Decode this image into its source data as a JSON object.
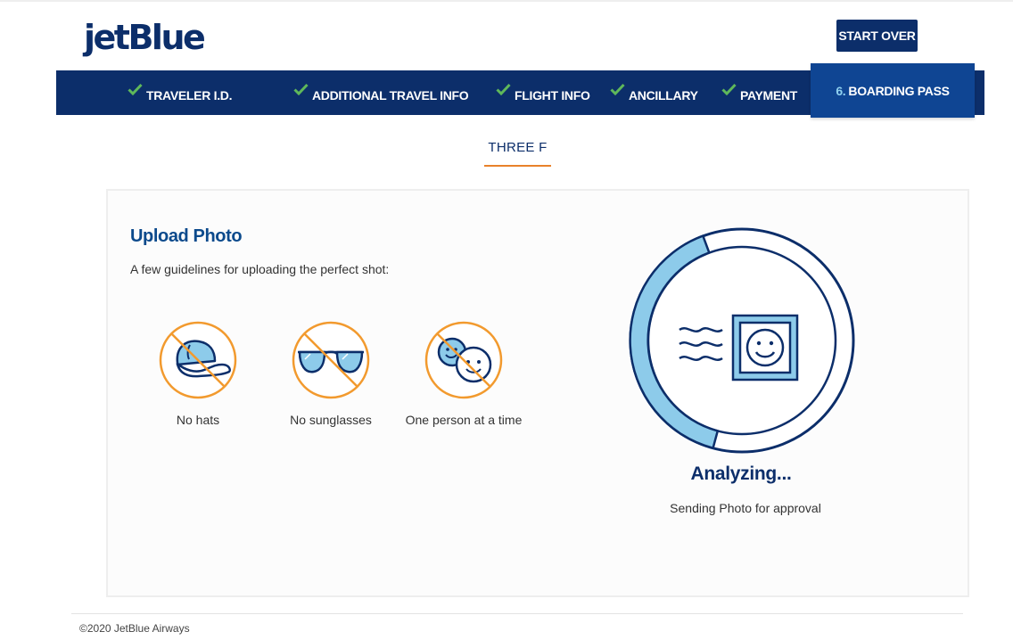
{
  "header": {
    "logo_text": "jetBlue",
    "start_over_label": "START OVER"
  },
  "steps": [
    {
      "label": "TRAVELER I.D.",
      "status": "complete"
    },
    {
      "label": "ADDITIONAL TRAVEL INFO",
      "status": "complete"
    },
    {
      "label": "FLIGHT INFO",
      "status": "complete"
    },
    {
      "label": "ANCILLARY",
      "status": "complete"
    },
    {
      "label": "PAYMENT",
      "status": "complete"
    },
    {
      "number": "6.",
      "label": "BOARDING PASS",
      "status": "active"
    }
  ],
  "passenger_tab": "THREE  F",
  "upload": {
    "title": "Upload Photo",
    "guidelines_text": "A few guidelines for uploading the perfect shot:",
    "guidelines": [
      {
        "icon": "no-hat-icon",
        "label": "No hats"
      },
      {
        "icon": "no-sunglasses-icon",
        "label": "No sunglasses"
      },
      {
        "icon": "one-person-icon",
        "label": "One person at a time"
      }
    ]
  },
  "status": {
    "icon": "photo-upload-progress-icon",
    "title": "Analyzing...",
    "subtitle": "Sending Photo for approval"
  },
  "footer": {
    "copyright": "©2020 JetBlue Airways"
  },
  "colors": {
    "brand_navy": "#0c2e6a",
    "active_blue": "#0f4593",
    "check_green": "#5fb85a",
    "accent_orange": "#e8812a",
    "light_blue": "#8dcbea"
  }
}
